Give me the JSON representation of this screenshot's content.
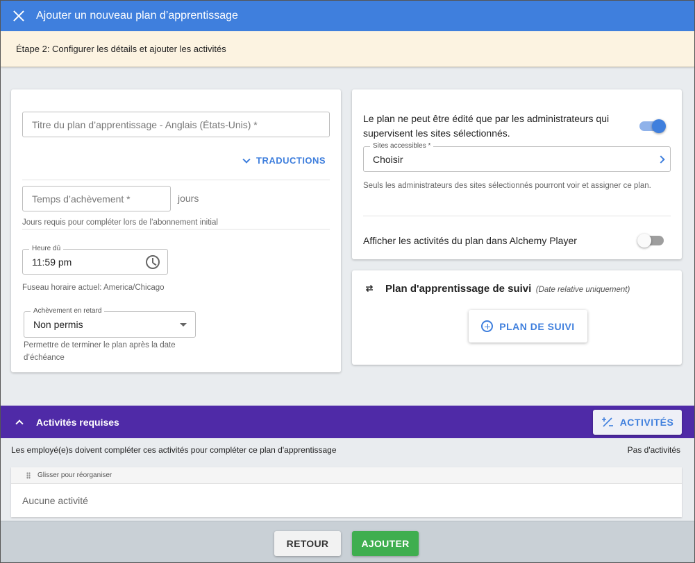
{
  "dialog": {
    "title": "Ajouter un nouveau plan d’apprentissage",
    "step": "Étape 2: Configurer les détails et ajouter les activités"
  },
  "left_card": {
    "title_field": {
      "placeholder": "Titre du plan d’apprentissage - Anglais (États-Unis) *"
    },
    "translations_label": "TRADUCTIONS",
    "completion_field": {
      "placeholder": "Temps d’achèvement *",
      "unit": "jours"
    },
    "completion_help": "Jours requis pour compléter lors de l’abonnement initial",
    "due_time": {
      "legend": "Heure dû",
      "value": "11:59 pm"
    },
    "timezone_text": "Fuseau horaire actuel: America/Chicago",
    "late_completion": {
      "legend": "Achèvement en retard",
      "value": "Non permis"
    },
    "late_help": "Permettre de terminer le plan après la date d’échéance"
  },
  "right_card": {
    "admin_edit_text": "Le plan ne peut être édité que par les administrateurs qui supervisent les sites sélectionnés.",
    "admin_edit_enabled": true,
    "sites": {
      "legend": "Sites accessibles *",
      "value": "Choisir"
    },
    "sites_help": "Seuls les administrateurs des sites sélectionnés pourront voir et assigner ce plan.",
    "player_text": "Afficher les activités du plan dans Alchemy Player",
    "player_enabled": false
  },
  "followup_card": {
    "title": "Plan d'apprentissage de suivi",
    "subtitle": "(Date relative uniquement)",
    "button_label": "PLAN DE SUIVI"
  },
  "required": {
    "title": "Activités requises",
    "button_label": "ACTIVITÉS",
    "description": "Les employé(e)s doivent compléter ces activités pour compléter ce plan d'apprentissage",
    "count_text": "Pas d'activités",
    "drag_hint": "Glisser pour réorganiser",
    "empty_text": "Aucune activité"
  },
  "footer": {
    "back_label": "RETOUR",
    "add_label": "AJOUTER"
  },
  "colors": {
    "primary": "#3f7fdd",
    "purple_bar": "#4f2aa7",
    "success": "#3fae4f",
    "step_banner": "#fcf3e1"
  },
  "icons": [
    "close-icon",
    "chevron-down-icon",
    "clock-icon",
    "caret-down-icon",
    "chevron-right-icon",
    "swap-icon",
    "plus-circle-icon",
    "chevron-up-icon",
    "add-list-icon",
    "drag-handle-icon"
  ]
}
